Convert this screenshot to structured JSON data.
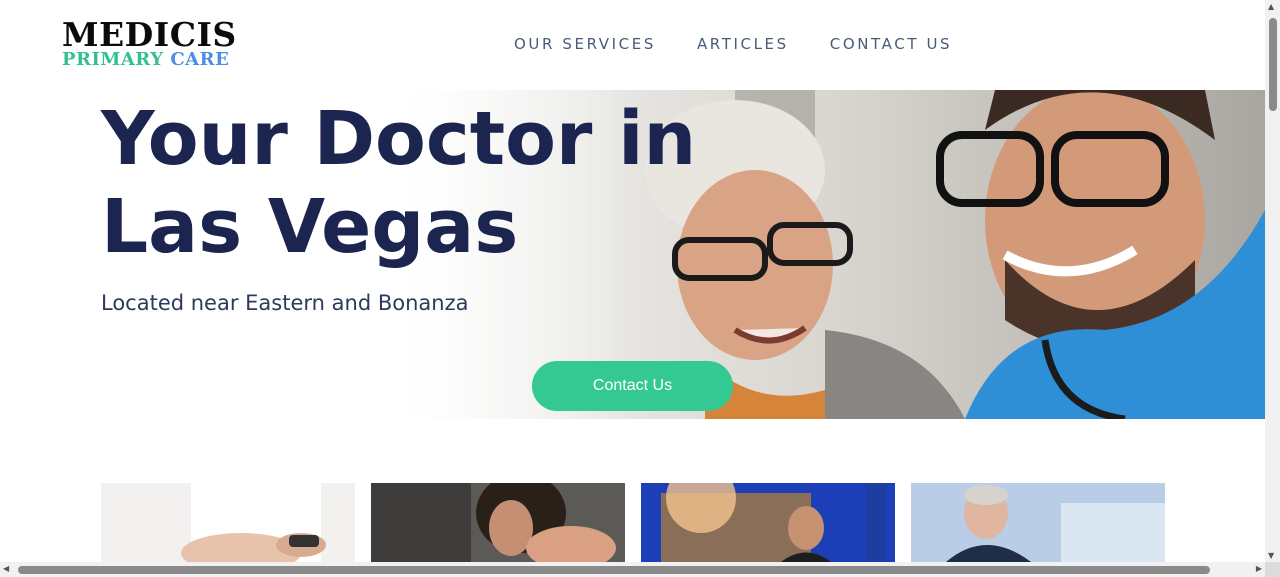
{
  "brand": {
    "name_top": "MEDICIS",
    "name_primary": "PRIMARY",
    "name_care": "CARE",
    "green": "#34c18f",
    "blue": "#4a8fe0"
  },
  "nav": {
    "items": [
      "OUR SERVICES",
      "ARTICLES",
      "CONTACT US"
    ]
  },
  "hero": {
    "title_line1": "Your Doctor in",
    "title_line2": "Las Vegas",
    "subtitle": "Located near Eastern and Bonanza",
    "cta_label": "Contact Us",
    "title_color": "#1c2550",
    "cta_color": "#34c992"
  },
  "cards": [
    {
      "image": "doctor-checking-patient-pulse"
    },
    {
      "image": "woman-with-neck-pain"
    },
    {
      "image": "smiling-driver-in-truck-cab"
    },
    {
      "image": "senior-doctor-portrait"
    }
  ]
}
